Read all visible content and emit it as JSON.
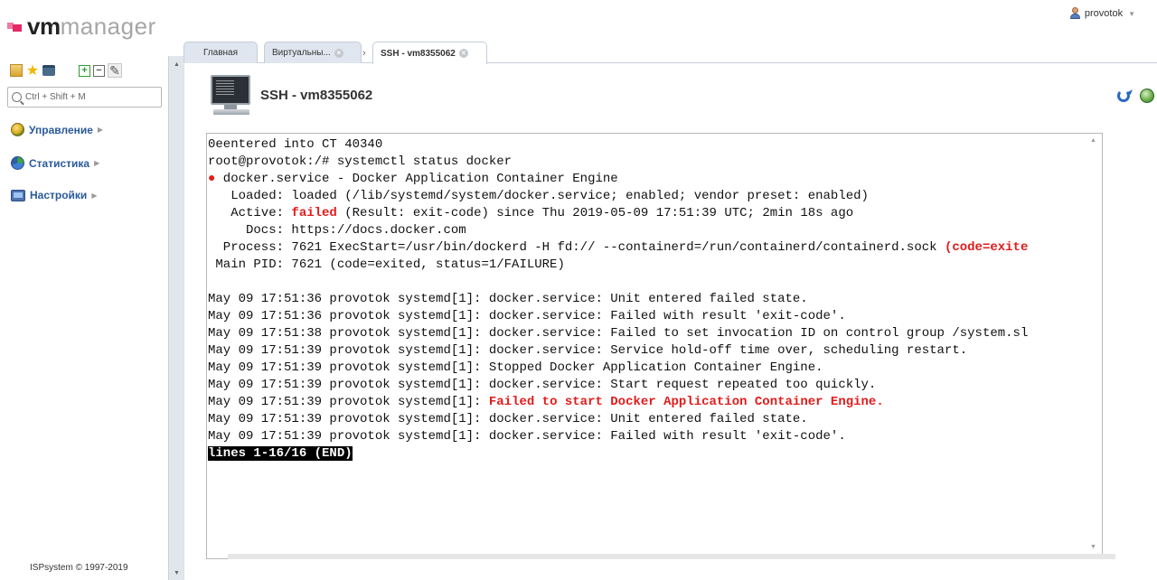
{
  "header": {
    "logo_vm": "vm",
    "logo_manager": "manager",
    "username": "provotok"
  },
  "sidebar": {
    "search_placeholder": "Ctrl + Shift + M",
    "items": [
      {
        "label": "Управление",
        "icon": "manage-icon"
      },
      {
        "label": "Статистика",
        "icon": "stats-icon"
      },
      {
        "label": "Настройки",
        "icon": "settings-icon"
      }
    ],
    "copyright": "ISPsystem © 1997-2019"
  },
  "tabs": [
    {
      "label": "Главная",
      "closable": false,
      "active": false
    },
    {
      "label": "Виртуальны...",
      "closable": true,
      "active": false
    },
    {
      "label": "SSH - vm8355062",
      "closable": true,
      "active": true
    }
  ],
  "page": {
    "title": "SSH - vm8355062"
  },
  "terminal": {
    "lines": [
      [
        {
          "t": "0eentered into CT 40340"
        }
      ],
      [
        {
          "t": "root@provotok:/# systemctl status docker"
        }
      ],
      [
        {
          "t": "●",
          "s": "red"
        },
        {
          "t": " docker.service - Docker Application Container Engine"
        }
      ],
      [
        {
          "t": "   Loaded: loaded (/lib/systemd/system/docker.service; enabled; vendor preset: enabled)"
        }
      ],
      [
        {
          "t": "   Active: "
        },
        {
          "t": "failed",
          "s": "red"
        },
        {
          "t": " (Result: exit-code) since Thu 2019-05-09 17:51:39 UTC; 2min 18s ago"
        }
      ],
      [
        {
          "t": "     Docs: https://docs.docker.com"
        }
      ],
      [
        {
          "t": "  Process: 7621 ExecStart=/usr/bin/dockerd -H fd:// --containerd=/run/containerd/containerd.sock "
        },
        {
          "t": "(code=exite",
          "s": "red"
        }
      ],
      [
        {
          "t": " Main PID: 7621 (code=exited, status=1/FAILURE)"
        }
      ],
      [
        {
          "t": ""
        }
      ],
      [
        {
          "t": "May 09 17:51:36 provotok systemd[1]: docker.service: Unit entered failed state."
        }
      ],
      [
        {
          "t": "May 09 17:51:36 provotok systemd[1]: docker.service: Failed with result 'exit-code'."
        }
      ],
      [
        {
          "t": "May 09 17:51:38 provotok systemd[1]: docker.service: Failed to set invocation ID on control group /system.sl"
        }
      ],
      [
        {
          "t": "May 09 17:51:39 provotok systemd[1]: docker.service: Service hold-off time over, scheduling restart."
        }
      ],
      [
        {
          "t": "May 09 17:51:39 provotok systemd[1]: Stopped Docker Application Container Engine."
        }
      ],
      [
        {
          "t": "May 09 17:51:39 provotok systemd[1]: docker.service: Start request repeated too quickly."
        }
      ],
      [
        {
          "t": "May 09 17:51:39 provotok systemd[1]: "
        },
        {
          "t": "Failed to start Docker Application Container Engine.",
          "s": "red"
        }
      ],
      [
        {
          "t": "May 09 17:51:39 provotok systemd[1]: docker.service: Unit entered failed state."
        }
      ],
      [
        {
          "t": "May 09 17:51:39 provotok systemd[1]: docker.service: Failed with result 'exit-code'."
        }
      ],
      [
        {
          "t": "lines 1-16/16 (END)",
          "s": "hl"
        }
      ]
    ]
  },
  "colors": {
    "accent_blue": "#2a5a9a",
    "error_red": "#e21b1b",
    "logo_pink": "#e32a66"
  }
}
